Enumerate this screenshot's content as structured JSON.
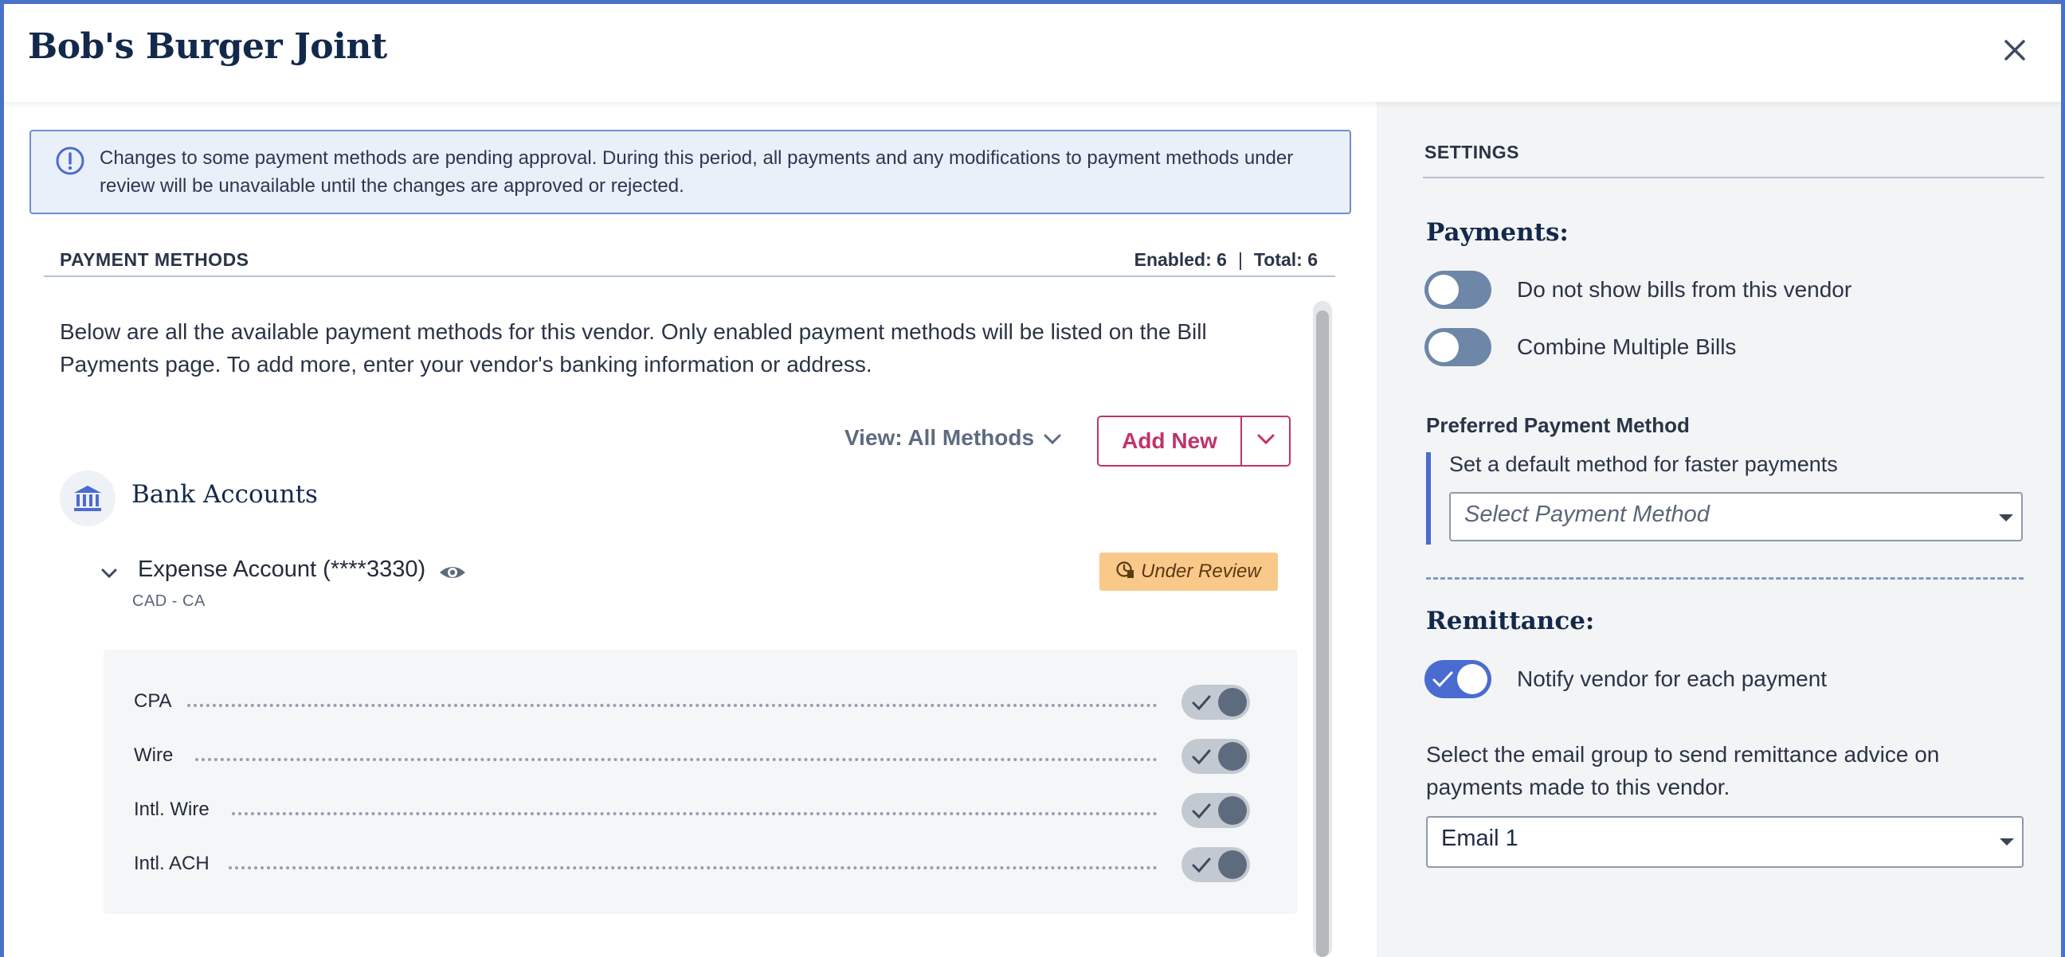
{
  "header": {
    "title": "Bob's Burger Joint",
    "close_icon": "close-icon"
  },
  "banner": {
    "icon": "info-icon",
    "text": "Changes to some payment methods are pending approval. During this period, all payments and any modifications to payment methods under review will be unavailable until the changes are approved or rejected."
  },
  "payment_methods": {
    "section_title": "PAYMENT METHODS",
    "enabled_label": "Enabled: 6",
    "separator": "|",
    "total_label": "Total: 6",
    "description": "Below are all the available payment methods for this vendor. Only enabled payment methods will be listed on the Bill Payments page. To add more, enter your vendor's banking information or address.",
    "view_label": "View: All Methods",
    "add_new_label": "Add New",
    "group_title": "Bank Accounts",
    "account": {
      "name": "Expense Account (****3330)",
      "sub": "CAD - CA",
      "status": "Under Review",
      "status_color": "#f9c98a"
    },
    "methods": [
      {
        "label": "CPA",
        "enabled": true
      },
      {
        "label": "Wire",
        "enabled": true
      },
      {
        "label": "Intl. Wire",
        "enabled": true
      },
      {
        "label": "Intl. ACH",
        "enabled": true
      }
    ]
  },
  "settings": {
    "title": "SETTINGS",
    "payments_heading": "Payments:",
    "toggles": [
      {
        "label": "Do not show bills from this vendor",
        "on": false
      },
      {
        "label": "Combine Multiple Bills",
        "on": false
      }
    ],
    "preferred_label": "Preferred Payment Method",
    "preferred_help": "Set a default method for faster payments",
    "preferred_placeholder": "Select Payment Method",
    "remittance_heading": "Remittance:",
    "notify_label": "Notify vendor for each payment",
    "notify_on": true,
    "remit_help": "Select the email group to send remittance advice on payments made to this vendor.",
    "email_value": "Email 1"
  },
  "colors": {
    "accent": "#4a6bd0",
    "brand_pink": "#c0336b",
    "navy": "#13294b"
  }
}
